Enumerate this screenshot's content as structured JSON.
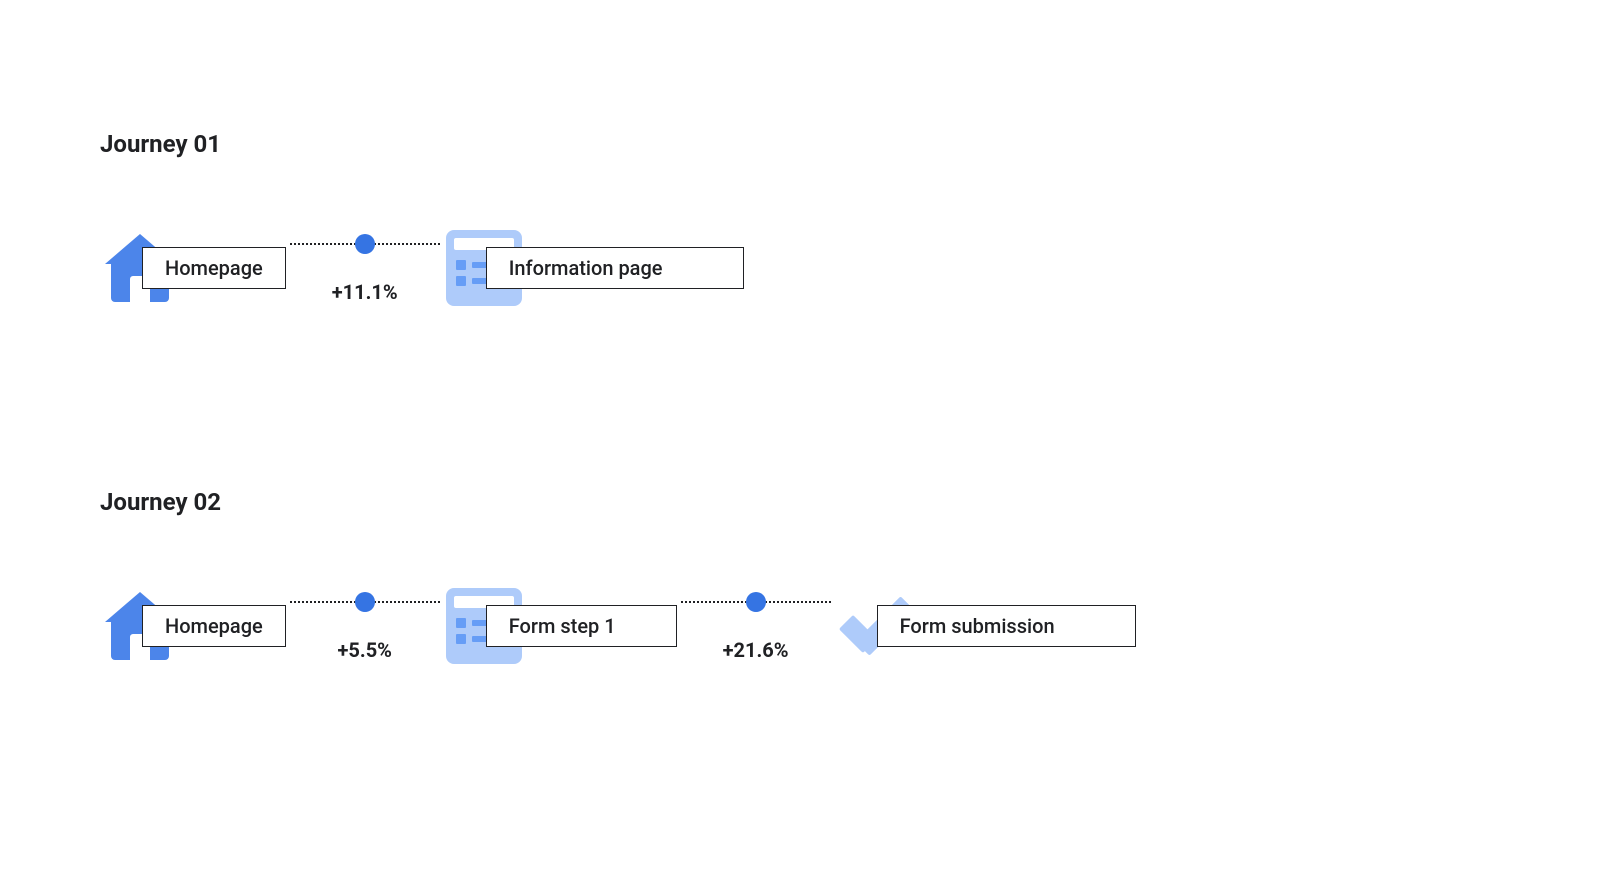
{
  "journeys": [
    {
      "title": "Journey 01",
      "steps": [
        {
          "icon": "home",
          "label": "Homepage"
        },
        {
          "icon": "list",
          "label": "Information page"
        }
      ],
      "connectors": [
        {
          "pct": "+11.1%"
        }
      ]
    },
    {
      "title": "Journey 02",
      "steps": [
        {
          "icon": "home",
          "label": "Homepage"
        },
        {
          "icon": "list",
          "label": "Form step 1"
        },
        {
          "icon": "check",
          "label": "Form submission"
        }
      ],
      "connectors": [
        {
          "pct": "+5.5%"
        },
        {
          "pct": "+21.6%"
        }
      ]
    }
  ],
  "colors": {
    "primary": "#4c85ea",
    "accent_light": "#aecbfa",
    "accent_mid": "#669df6",
    "dot": "#3574e3",
    "text": "#202124"
  }
}
